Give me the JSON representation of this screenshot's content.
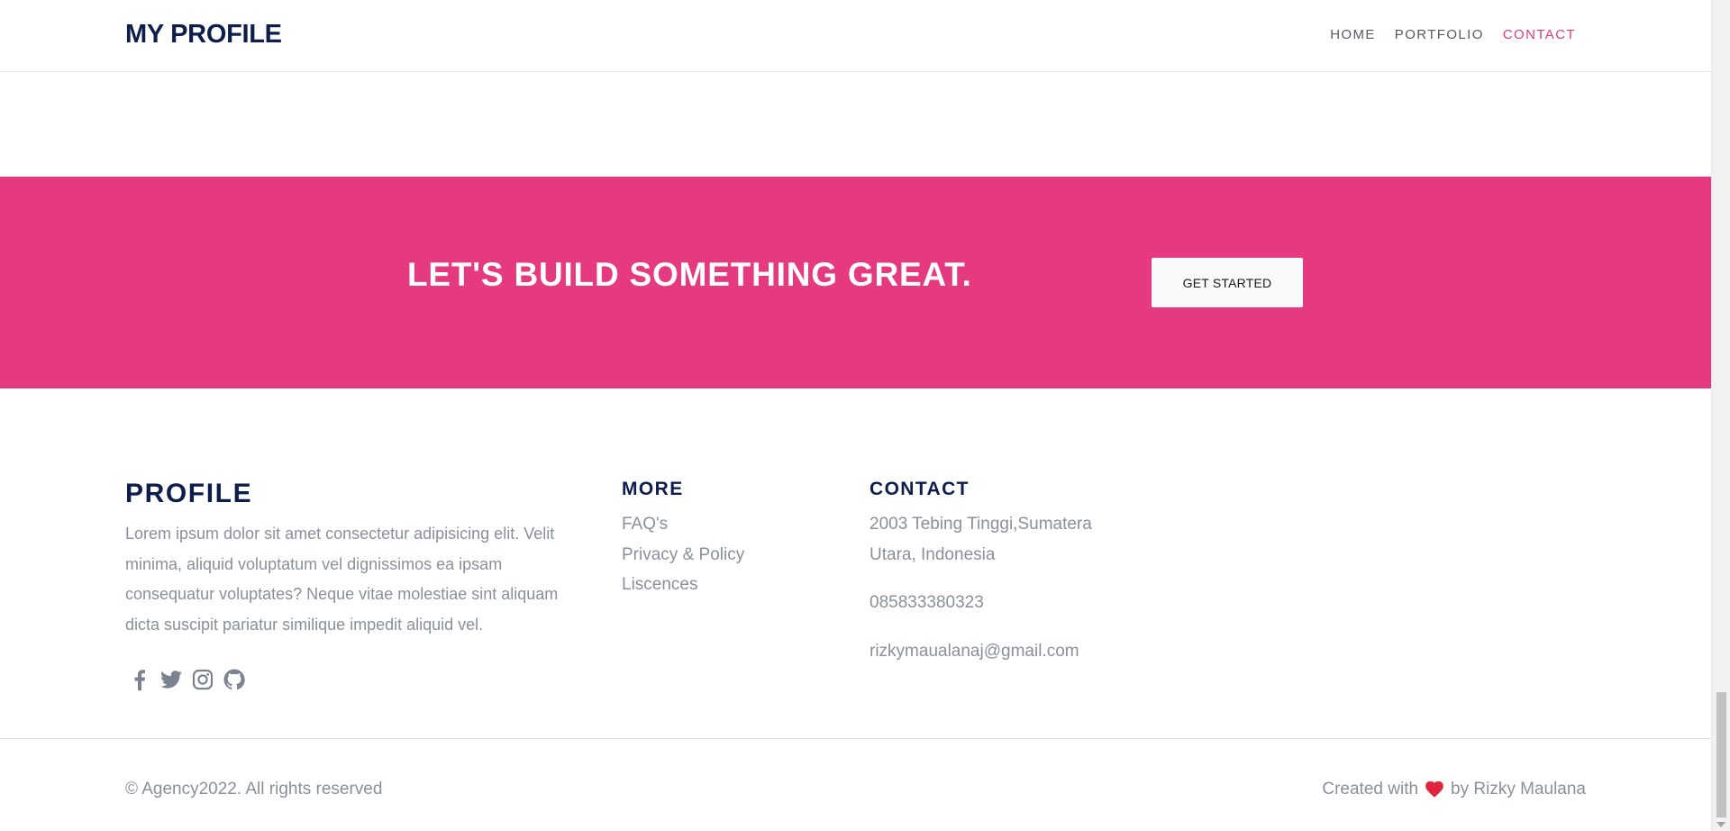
{
  "navbar": {
    "brand": "MY PROFILE",
    "links": [
      {
        "label": "HOME",
        "active": false
      },
      {
        "label": "PORTFOLIO",
        "active": false
      },
      {
        "label": "CONTACT",
        "active": true
      }
    ]
  },
  "cta": {
    "title": "LET'S BUILD SOMETHING GREAT.",
    "button_label": "GET STARTED",
    "background_color": "#e63a80"
  },
  "footer": {
    "profile": {
      "title": "PROFILE",
      "text": "Lorem ipsum dolor sit amet consectetur adipisicing elit. Velit minima, aliquid voluptatum vel dignissimos ea ipsam consequatur voluptates? Neque vitae molestiae sint aliquam dicta suscipit pariatur similique impedit aliquid vel.",
      "socials": [
        "facebook-icon",
        "twitter-icon",
        "instagram-icon",
        "github-icon"
      ]
    },
    "more": {
      "title": "MORE",
      "links": [
        "FAQ's",
        "Privacy & Policy",
        "Liscences"
      ]
    },
    "contact": {
      "title": "CONTACT",
      "address": "2003 Tebing Tinggi,Sumatera Utara, Indonesia",
      "phone": "085833380323",
      "email": "rizkymaualanaj@gmail.com"
    },
    "copyright": "© Agency2022. All rights reserved",
    "credits_prefix": "Created with",
    "credits_suffix": "by Rizky Maulana",
    "heart_color": "#e0263f"
  },
  "colors": {
    "navy": "#0d1e4c",
    "accent": "#e13a7f",
    "muted_text": "#8a8f9c"
  }
}
